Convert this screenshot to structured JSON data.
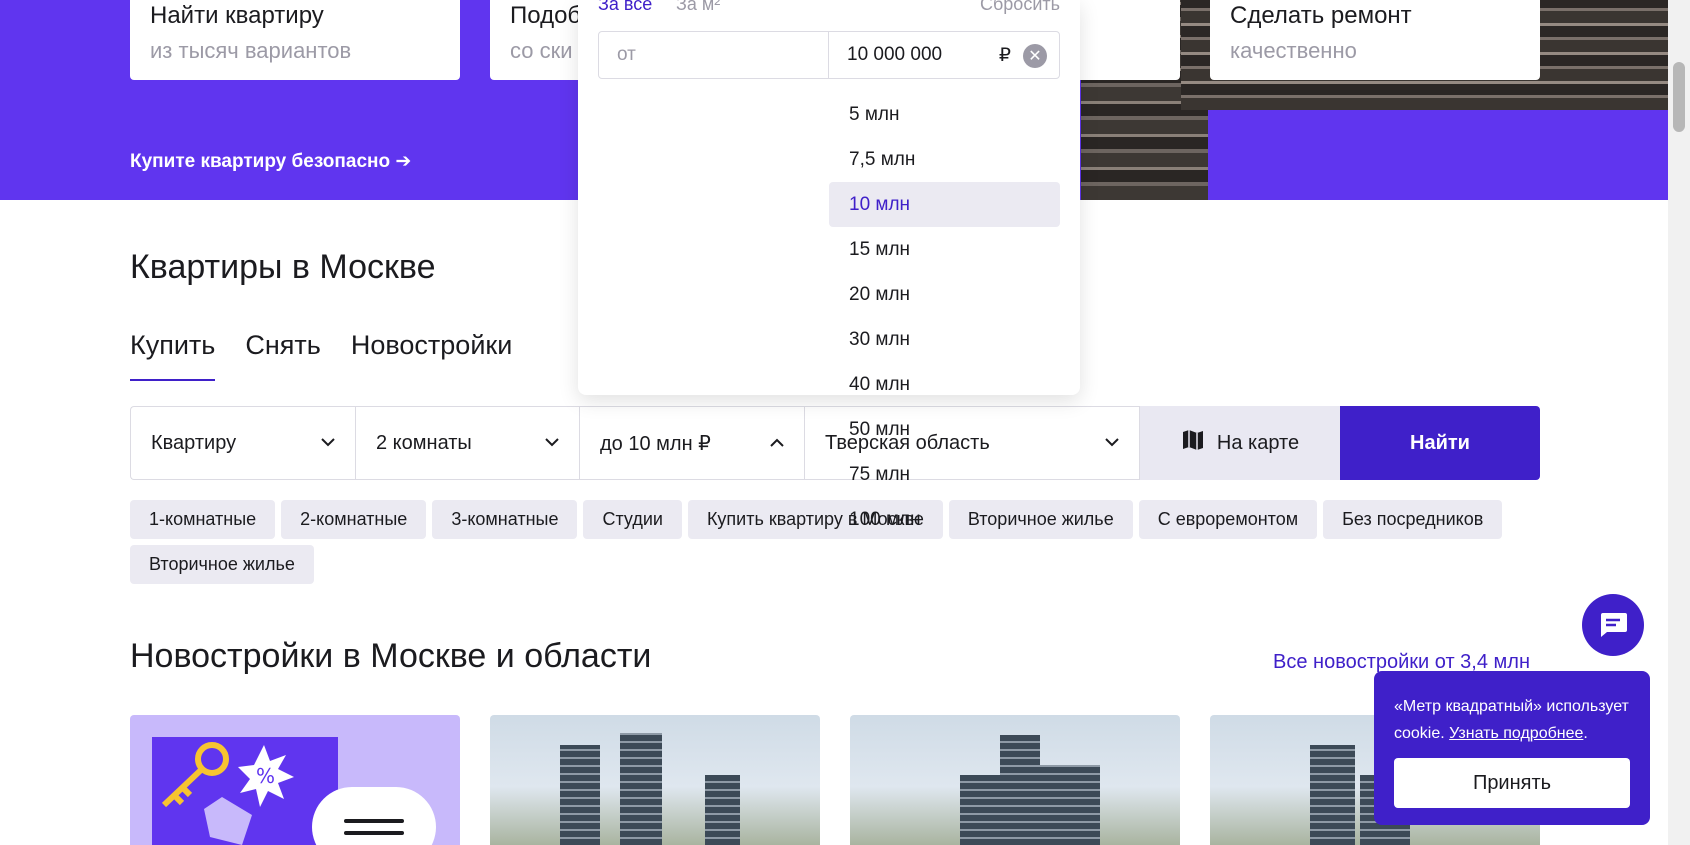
{
  "hero": {
    "cards": [
      {
        "title": "Найти квартиру",
        "subtitle": "из тысяч вариантов"
      },
      {
        "title": "Подоб",
        "subtitle": "со ски"
      },
      {
        "title": "Сделать ремонт",
        "subtitle": "качественно"
      }
    ],
    "safe_link": "Купите квартиру безопасно ➔"
  },
  "section_title": "Квартиры в Москве",
  "tabs": [
    "Купить",
    "Снять",
    "Новостройки"
  ],
  "search": {
    "type": "Квартиру",
    "rooms": "2 комнаты",
    "price": "до 10 млн ₽",
    "region": "Тверская область",
    "map_label": "На карте",
    "find_label": "Найти"
  },
  "chips": [
    "1-комнатные",
    "2-комнатные",
    "3-комнатные",
    "Студии",
    "Купить квартиру в Москве",
    "Вторичное жилье",
    "С евроремонтом",
    "Без посредников",
    "Вторичное жилье"
  ],
  "newbuild_title": "Новостройки в Москве и области",
  "all_newbuild_link": "Все новостройки от 3,4 млн",
  "dropdown": {
    "mode_all": "За все",
    "mode_sqm": "За м²",
    "reset": "Сбросить",
    "from_placeholder": "от",
    "to_value": "10 000 000",
    "currency": "₽",
    "options": [
      "5 млн",
      "7,5 млн",
      "10 млн",
      "15 млн",
      "20 млн",
      "30 млн",
      "40 млн",
      "50 млн",
      "75 млн",
      "100 млн"
    ],
    "selected": "10 млн"
  },
  "cookie": {
    "text": "«Метр квадратный» использует cookie.",
    "link": "Узнать подробнее",
    "accept": "Принять"
  },
  "colors": {
    "brand": "#3f20c9",
    "hero": "#6035ef",
    "chip": "#ebeaf2"
  }
}
